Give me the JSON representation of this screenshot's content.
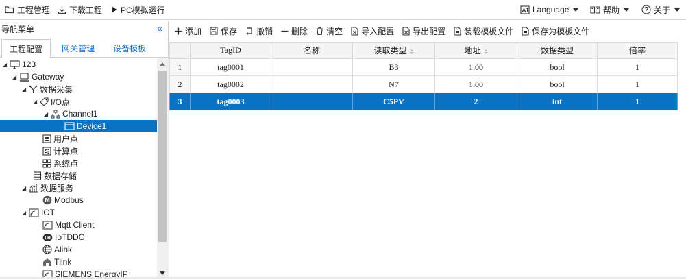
{
  "menu": {
    "project": "工程管理",
    "download": "下载工程",
    "simulate": "PC模拟运行",
    "language": "Language",
    "help": "帮助",
    "about": "关于"
  },
  "nav": {
    "title": "导航菜单",
    "collapse": "«",
    "tabs": [
      "工程配置",
      "网关管理",
      "设备模板"
    ]
  },
  "tree": [
    {
      "label": "123",
      "icon": "monitor-icon"
    },
    {
      "label": "Gateway",
      "icon": "gateway-icon"
    },
    {
      "label": "数据采集",
      "icon": "collect-icon"
    },
    {
      "label": "I/O点",
      "icon": "tag-icon"
    },
    {
      "label": "Channel1",
      "icon": "channel-icon"
    },
    {
      "label": "Device1",
      "icon": "device-icon"
    },
    {
      "label": "用户点",
      "icon": "user-point-icon"
    },
    {
      "label": "计算点",
      "icon": "calc-point-icon"
    },
    {
      "label": "系统点",
      "icon": "system-point-icon"
    },
    {
      "label": "数据存储",
      "icon": "storage-icon"
    },
    {
      "label": "数据服务",
      "icon": "service-icon"
    },
    {
      "label": "Modbus",
      "icon": "modbus-icon"
    },
    {
      "label": "IOT",
      "icon": "iot-icon"
    },
    {
      "label": "Mqtt Client",
      "icon": "mqtt-icon"
    },
    {
      "label": "IoTDDC",
      "icon": "iotddc-icon"
    },
    {
      "label": "Alink",
      "icon": "globe-icon"
    },
    {
      "label": "Tlink",
      "icon": "tlink-icon"
    },
    {
      "label": "SIEMENS EnergyIP",
      "icon": "siemens-icon"
    }
  ],
  "toolbar": {
    "add": "添加",
    "save": "保存",
    "undo": "撤销",
    "delete": "删除",
    "clear": "清空",
    "import": "导入配置",
    "export": "导出配置",
    "load_template": "装载模板文件",
    "save_template": "保存为模板文件"
  },
  "table": {
    "headers": [
      "TagID",
      "名称",
      "读取类型",
      "地址",
      "数据类型",
      "倍率"
    ],
    "rows": [
      {
        "n": "1",
        "tagid": "tag0001",
        "name": "",
        "read_type": "B3",
        "address": "1.00",
        "data_type": "bool",
        "rate": "1"
      },
      {
        "n": "2",
        "tagid": "tag0002",
        "name": "",
        "read_type": "N7",
        "address": "1.00",
        "data_type": "bool",
        "rate": "1"
      },
      {
        "n": "3",
        "tagid": "tag0003",
        "name": "",
        "read_type": "C5PV",
        "address": "2",
        "data_type": "int",
        "rate": "1"
      }
    ]
  }
}
